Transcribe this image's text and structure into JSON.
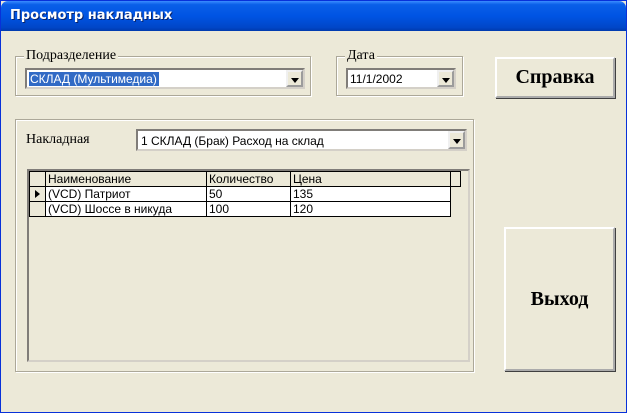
{
  "window": {
    "title": "Просмотр накладных"
  },
  "department": {
    "legend": "Подразделение",
    "value": "СКЛАД (Мультимедиа)"
  },
  "date": {
    "legend": "Дата",
    "value": "11/1/2002"
  },
  "buttons": {
    "help": "Справка",
    "exit": "Выход"
  },
  "invoice": {
    "label": "Накладная",
    "value": "1  СКЛАД (Брак)  Расход на склад"
  },
  "table": {
    "headers": [
      "Наименование",
      "Количество",
      "Цена"
    ],
    "rows": [
      {
        "name": "(VCD) Патриот",
        "qty": "50",
        "price": "135"
      },
      {
        "name": "(VCD) Шоссе в никуда",
        "qty": "100",
        "price": "120"
      }
    ]
  },
  "icons": {
    "row_indicator": "current-row-arrow-icon",
    "dropdown": "chevron-down-icon"
  }
}
